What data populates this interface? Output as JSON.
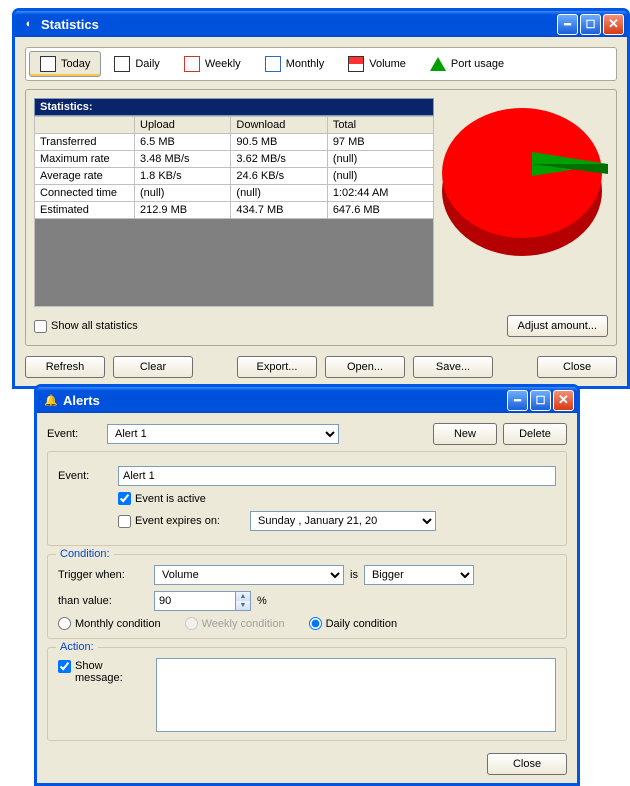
{
  "statsWindow": {
    "title": "Statistics",
    "tabs": [
      {
        "label": "Today"
      },
      {
        "label": "Daily"
      },
      {
        "label": "Weekly"
      },
      {
        "label": "Monthly"
      },
      {
        "label": "Volume"
      },
      {
        "label": "Port usage"
      }
    ],
    "tableHeader": "Statistics:",
    "columns": [
      "",
      "Upload",
      "Download",
      "Total"
    ],
    "rows": [
      {
        "name": "Transferred",
        "up": "6.5 MB",
        "down": "90.5 MB",
        "total": "97 MB"
      },
      {
        "name": "Maximum rate",
        "up": "3.48 MB/s",
        "down": "3.62 MB/s",
        "total": "(null)"
      },
      {
        "name": "Average rate",
        "up": "1.8 KB/s",
        "down": "24.6 KB/s",
        "total": "(null)"
      },
      {
        "name": "Connected time",
        "up": "(null)",
        "down": "(null)",
        "total": "1:02:44 AM"
      },
      {
        "name": "Estimated",
        "up": "212.9 MB",
        "down": "434.7 MB",
        "total": "647.6 MB"
      }
    ],
    "showAll": "Show all statistics",
    "adjust": "Adjust amount...",
    "buttons": {
      "refresh": "Refresh",
      "clear": "Clear",
      "export": "Export...",
      "open": "Open...",
      "save": "Save...",
      "close": "Close"
    }
  },
  "alertsWindow": {
    "title": "Alerts",
    "topEventLabel": "Event:",
    "topEventValue": "Alert 1",
    "new": "New",
    "delete": "Delete",
    "sec1": {
      "eventLabel": "Event:",
      "eventValue": "Alert 1",
      "activeLabel": "Event is active",
      "activeChecked": true,
      "expiresLabel": "Event expires on:",
      "expiresChecked": false,
      "expiresDate": "Sunday   ,  January   21, 20"
    },
    "condition": {
      "legend": "Condition:",
      "triggerLabel": "Trigger when:",
      "metric": "Volume",
      "isLabel": "is",
      "comparator": "Bigger",
      "thanLabel": "than value:",
      "value": "90",
      "percent": "%",
      "monthly": "Monthly condition",
      "weekly": "Weekly condition",
      "daily": "Daily condition",
      "selected": "daily"
    },
    "action": {
      "legend": "Action:",
      "showMsgLabel": "Show message:",
      "showMsgChecked": true,
      "message": ""
    },
    "close": "Close"
  },
  "chart_data": {
    "type": "pie",
    "title": "",
    "series": [
      {
        "name": "Upload",
        "value": 6.5,
        "color": "#00a000"
      },
      {
        "name": "Download",
        "value": 90.5,
        "color": "#ff0000"
      }
    ]
  }
}
